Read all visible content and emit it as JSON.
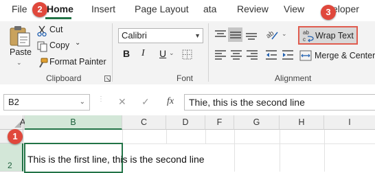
{
  "menu": {
    "file": "File",
    "home": "Home",
    "insert": "Insert",
    "page_layout": "Page Layout",
    "data": "ata",
    "review": "Review",
    "view": "View",
    "developer": "eloper"
  },
  "callouts": {
    "one": "1",
    "two": "2",
    "three": "3"
  },
  "clipboard": {
    "paste": "Paste",
    "cut": "Cut",
    "copy": "Copy",
    "format_painter": "Format Painter",
    "label": "Clipboard"
  },
  "font": {
    "name": "Calibri",
    "bold": "B",
    "italic": "I",
    "underline": "U",
    "label": "Font"
  },
  "alignment": {
    "wrap_text": "Wrap Text",
    "merge_center": "Merge & Center",
    "label": "Alignment"
  },
  "formula_bar": {
    "name_box": "B2",
    "cancel": "✕",
    "enter": "✓",
    "fx": "fx",
    "content": "Thie, this is the second line"
  },
  "sheet": {
    "columns": [
      "A",
      "B",
      "C",
      "D",
      "F",
      "G",
      "H",
      "I"
    ],
    "rows": [
      "1",
      "2"
    ],
    "cell_b2": "This is the first line, this is the second line"
  },
  "colors": {
    "accent": "#217346",
    "callout": "#e0483c"
  }
}
